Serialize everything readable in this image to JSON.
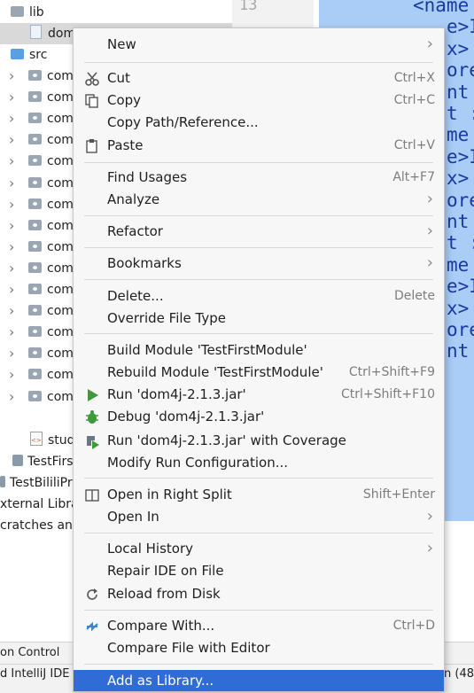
{
  "project_tree": {
    "lib_label": "lib",
    "jar_label": "dom",
    "src_label": "src",
    "packages": [
      "com",
      "com",
      "com",
      "com",
      "com",
      "com",
      "com",
      "com",
      "com",
      "com",
      "com",
      "com",
      "com",
      "com",
      "com",
      "com",
      "com"
    ],
    "student_file": "stud",
    "module_file": "TestFirs",
    "project_label": "TestBililiPr",
    "external_libs": "xternal Libra",
    "scratches": "cratches and"
  },
  "editor": {
    "line_number": "13",
    "code_lines": [
      "<name",
      "e>I",
      "x>",
      "ore",
      "nt",
      "t :",
      "me",
      "e>I",
      "x>",
      "ore",
      "nt",
      "t :",
      "me",
      "e>I",
      "x>",
      "ore",
      "nt"
    ]
  },
  "bottom_toolbar": {
    "label": "on Control"
  },
  "status_bar": {
    "message": "d IntelliJ IDE",
    "position": "n (48"
  },
  "context_menu": {
    "items": {
      "new": "New",
      "cut": "Cut",
      "cut_shortcut": "Ctrl+X",
      "copy": "Copy",
      "copy_shortcut": "Ctrl+C",
      "copy_path": "Copy Path/Reference...",
      "paste": "Paste",
      "paste_shortcut": "Ctrl+V",
      "find_usages": "Find Usages",
      "find_usages_shortcut": "Alt+F7",
      "analyze": "Analyze",
      "refactor": "Refactor",
      "bookmarks": "Bookmarks",
      "delete": "Delete...",
      "delete_shortcut": "Delete",
      "override_file_type": "Override File Type",
      "build_module": "Build Module 'TestFirstModule'",
      "rebuild_module": "Rebuild Module 'TestFirstModule'",
      "rebuild_shortcut": "Ctrl+Shift+F9",
      "run": "Run 'dom4j-2.1.3.jar'",
      "run_shortcut": "Ctrl+Shift+F10",
      "debug": "Debug 'dom4j-2.1.3.jar'",
      "run_coverage": "Run 'dom4j-2.1.3.jar' with Coverage",
      "modify_run_config": "Modify Run Configuration...",
      "open_right_split": "Open in Right Split",
      "open_right_split_shortcut": "Shift+Enter",
      "open_in": "Open In",
      "local_history": "Local History",
      "repair_ide": "Repair IDE on File",
      "reload_disk": "Reload from Disk",
      "compare_with": "Compare With...",
      "compare_with_shortcut": "Ctrl+D",
      "compare_file_editor": "Compare File with Editor",
      "add_as_library": "Add as Library..."
    }
  },
  "colors": {
    "highlight": "#2f6cd6",
    "editor_selection": "#a9cdf7",
    "code_tag": "#1a3a9f",
    "run_green": "#3c9a3c"
  },
  "icons": [
    "scissors-icon",
    "copy-icon",
    "paste-icon",
    "run-icon",
    "debug-icon",
    "coverage-icon",
    "split-icon",
    "reload-icon",
    "compare-icon",
    "submenu-arrow-icon"
  ]
}
